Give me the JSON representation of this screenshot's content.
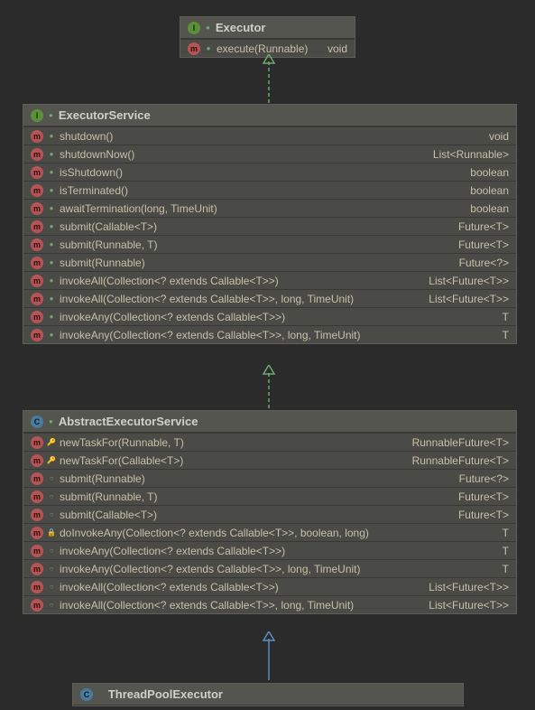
{
  "executor": {
    "name": "Executor",
    "kind": "interface",
    "methods": [
      {
        "sig": "execute(Runnable)",
        "ret": "void",
        "abstract": true
      }
    ]
  },
  "executorService": {
    "name": "ExecutorService",
    "kind": "interface",
    "methods": [
      {
        "sig": "shutdown()",
        "ret": "void",
        "abstract": true
      },
      {
        "sig": "shutdownNow()",
        "ret": "List<Runnable>",
        "abstract": true
      },
      {
        "sig": "isShutdown()",
        "ret": "boolean",
        "abstract": true
      },
      {
        "sig": "isTerminated()",
        "ret": "boolean",
        "abstract": true
      },
      {
        "sig": "awaitTermination(long, TimeUnit)",
        "ret": "boolean",
        "abstract": true
      },
      {
        "sig": "submit(Callable<T>)",
        "ret": "Future<T>",
        "abstract": true
      },
      {
        "sig": "submit(Runnable, T)",
        "ret": "Future<T>",
        "abstract": true
      },
      {
        "sig": "submit(Runnable)",
        "ret": "Future<?>",
        "abstract": true
      },
      {
        "sig": "invokeAll(Collection<? extends Callable<T>>)",
        "ret": "List<Future<T>>",
        "abstract": true
      },
      {
        "sig": "invokeAll(Collection<? extends Callable<T>>, long, TimeUnit)",
        "ret": "List<Future<T>>",
        "abstract": true
      },
      {
        "sig": "invokeAny(Collection<? extends Callable<T>>)",
        "ret": "T",
        "abstract": true
      },
      {
        "sig": "invokeAny(Collection<? extends Callable<T>>, long, TimeUnit)",
        "ret": "T",
        "abstract": true
      }
    ]
  },
  "abstractExecutorService": {
    "name": "AbstractExecutorService",
    "kind": "class",
    "methods": [
      {
        "sig": "newTaskFor(Runnable, T)",
        "ret": "RunnableFuture<T>",
        "vis": "protected"
      },
      {
        "sig": "newTaskFor(Callable<T>)",
        "ret": "RunnableFuture<T>",
        "vis": "protected"
      },
      {
        "sig": "submit(Runnable)",
        "ret": "Future<?>",
        "vis": "public"
      },
      {
        "sig": "submit(Runnable, T)",
        "ret": "Future<T>",
        "vis": "public"
      },
      {
        "sig": "submit(Callable<T>)",
        "ret": "Future<T>",
        "vis": "public"
      },
      {
        "sig": "doInvokeAny(Collection<? extends Callable<T>>, boolean, long)",
        "ret": "T",
        "vis": "private"
      },
      {
        "sig": "invokeAny(Collection<? extends Callable<T>>)",
        "ret": "T",
        "vis": "public"
      },
      {
        "sig": "invokeAny(Collection<? extends Callable<T>>, long, TimeUnit)",
        "ret": "T",
        "vis": "public"
      },
      {
        "sig": "invokeAll(Collection<? extends Callable<T>>)",
        "ret": "List<Future<T>>",
        "vis": "public"
      },
      {
        "sig": "invokeAll(Collection<? extends Callable<T>>, long, TimeUnit)",
        "ret": "List<Future<T>>",
        "vis": "public"
      }
    ]
  },
  "threadPoolExecutor": {
    "name": "ThreadPoolExecutor",
    "kind": "class"
  }
}
